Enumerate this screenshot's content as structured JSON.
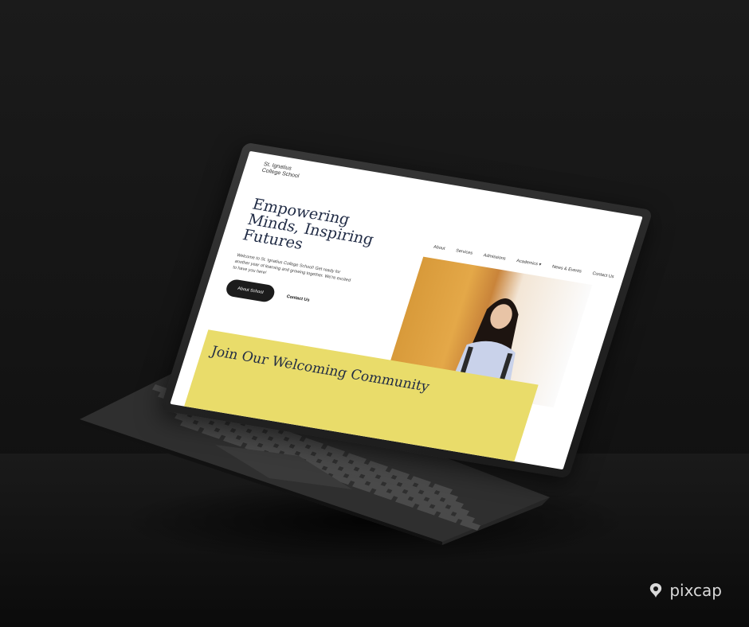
{
  "site": {
    "school_name": "St. Ignatius College School",
    "nav": [
      "About",
      "Services",
      "Admissions",
      "Academics",
      "News & Events",
      "Contact Us"
    ],
    "hero_title": "Empowering Minds, Inspiring Futures",
    "hero_text": "Welcome to St. Ignatius College School! Get ready for another year of learning and growing together. We're excited to have you here!",
    "about_button": "About School",
    "contact_link": "Contact Us",
    "join_title": "Join Our Welcoming Community"
  },
  "watermark": {
    "text": "pixcap",
    "icon": "pixcap-logo-icon"
  },
  "colors": {
    "background": "#161616",
    "band_yellow": "#e9dc6a",
    "title_navy": "#1f2a44",
    "button_dark": "#1c1c1c",
    "photo_orange": "#d89a3a"
  }
}
